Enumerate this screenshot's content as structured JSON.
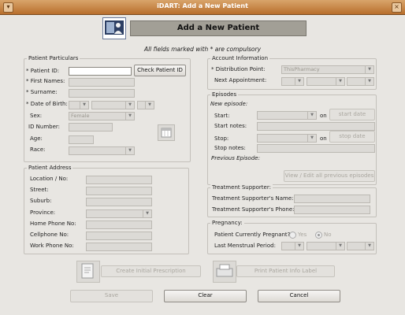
{
  "window": {
    "title": "iDART: Add a New Patient",
    "close_glyph": "×"
  },
  "header": {
    "title": "Add a New Patient",
    "icon": "patient-card-icon"
  },
  "note": "All fields marked with * are compulsory",
  "particulars": {
    "title": "Patient Particulars",
    "patient_id_label": "* Patient ID:",
    "first_names_label": "* First Names:",
    "surname_label": "* Surname:",
    "dob_label": "* Date of Birth:",
    "sex_label": "Sex:",
    "sex_value": "Female",
    "id_number_label": "ID Number:",
    "age_label": "Age:",
    "race_label": "Race:",
    "check_button": "Check Patient ID",
    "calendar_icon": "calendar-icon"
  },
  "address": {
    "title": "Patient Address",
    "location_label": "Location / No:",
    "street_label": "Street:",
    "suburb_label": "Suburb:",
    "province_label": "Province:",
    "home_phone_label": "Home Phone No:",
    "cell_phone_label": "Cellphone No:",
    "work_phone_label": "Work Phone No:"
  },
  "account": {
    "title": "Account Information",
    "distribution_label": "* Distribution Point:",
    "distribution_value": "ThisPharmacy",
    "next_appt_label": "Next Appointment:"
  },
  "episodes": {
    "title": "Episodes",
    "new_episode_label": "New episode:",
    "start_label": "Start:",
    "on_label1": "on",
    "start_date_button": "start date",
    "start_notes_label": "Start notes:",
    "stop_label": "Stop:",
    "on_label2": "on",
    "stop_date_button": "stop date",
    "stop_notes_label": "Stop notes:",
    "previous_label": "Previous Episode:",
    "view_button": "View / Edit all previous episodes"
  },
  "supporter": {
    "title": "Treatment Supporter:",
    "name_label": "Treatment Supporter's Name:",
    "phone_label": "Treatment Supporter's Phone:"
  },
  "pregnancy": {
    "title": "Pregnancy:",
    "pregnant_label": "Patient Currently Pregnant?",
    "yes_label": "Yes",
    "no_label": "No",
    "lmp_label": "Last Menstrual Period:"
  },
  "actions": {
    "create_prescription": "Create Initial Prescription",
    "print_label": "Print Patient Info Label",
    "save": "Save",
    "clear": "Clear",
    "cancel": "Cancel"
  }
}
